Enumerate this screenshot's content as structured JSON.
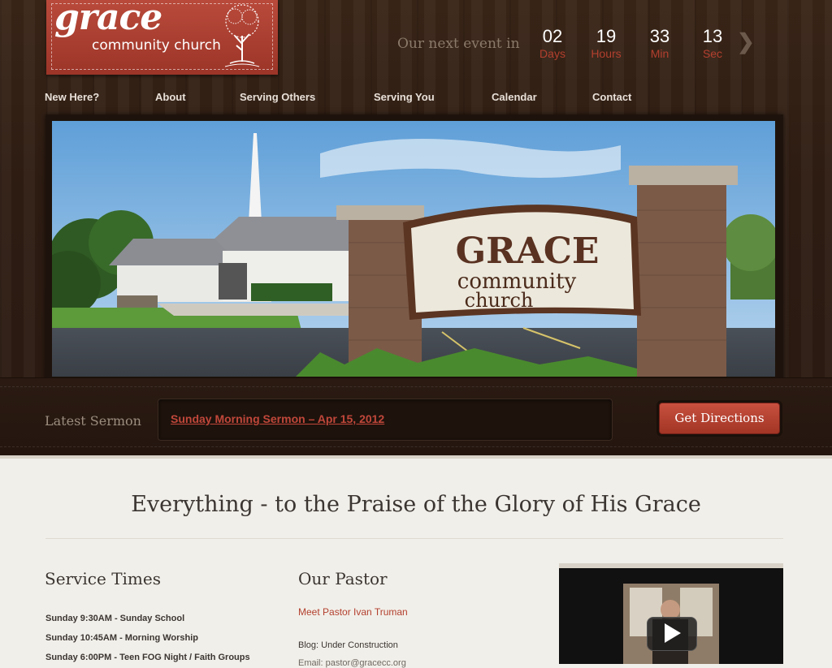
{
  "brand": {
    "logo_title": "grace",
    "logo_subtitle": "community church",
    "colors": {
      "accent": "#b3402f",
      "wood": "#2f1d13",
      "page": "#f1efe9"
    }
  },
  "event": {
    "label": "Our next event in",
    "countdown": [
      {
        "value": "02",
        "unit": "Days"
      },
      {
        "value": "19",
        "unit": "Hours"
      },
      {
        "value": "33",
        "unit": "Min"
      },
      {
        "value": "13",
        "unit": "Sec"
      }
    ],
    "next_icon": "chevron-right-icon"
  },
  "nav": {
    "items": [
      "New Here?",
      "About",
      "Serving Others",
      "Serving You",
      "Calendar",
      "Contact"
    ]
  },
  "hero": {
    "sign_line1": "GRACE",
    "sign_line2": "community",
    "sign_line3": "church"
  },
  "sermon": {
    "label": "Latest Sermon",
    "link_text": "Sunday Morning Sermon – Apr 15, 2012",
    "directions_label": "Get Directions"
  },
  "main": {
    "tagline": "Everything - to the Praise of the Glory of His Grace",
    "service_times": {
      "heading": "Service Times",
      "items": [
        "Sunday 9:30AM - Sunday School",
        "Sunday 10:45AM - Morning Worship",
        "Sunday 6:00PM - Teen FOG Night / Faith Groups"
      ]
    },
    "pastor": {
      "heading": "Our Pastor",
      "link": "Meet Pastor Ivan Truman",
      "blog": "Blog: Under Construction",
      "partial": "Email: pastor@gracecc.org"
    },
    "video": {
      "play_icon": "play-icon"
    }
  }
}
